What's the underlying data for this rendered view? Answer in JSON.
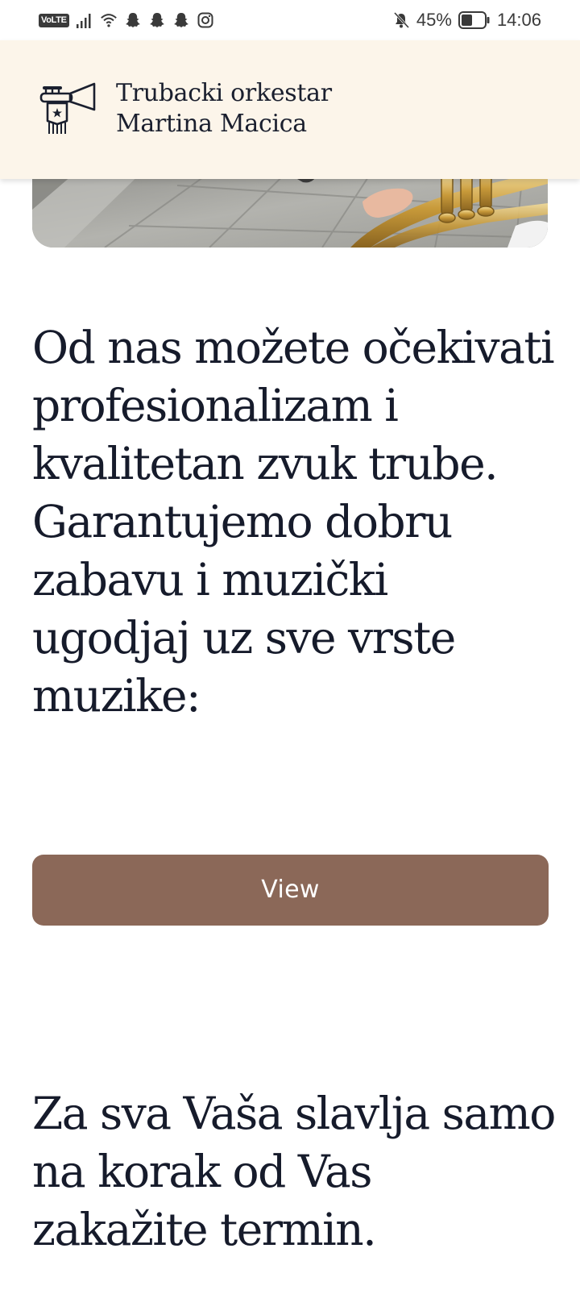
{
  "status_bar": {
    "network_badge": "VoLTE",
    "battery_percent": "45%",
    "time": "14:06",
    "icons": [
      "signal-icon",
      "wifi-icon",
      "snapchat-icon",
      "snapchat-icon",
      "snapchat-icon",
      "instagram-icon",
      "bell-off-icon",
      "battery-icon"
    ]
  },
  "header": {
    "brand_line1": "Trubacki orkestar",
    "brand_line2": "Martina Macica",
    "logo_icon": "trumpet-logo-icon",
    "background": "#fcf5ea"
  },
  "hero_image": {
    "subject": "trumpet"
  },
  "main": {
    "intro_text": "Od nas možete očekivati profesionalizam i kvalitetan zvuk trube. Garantujemo dobru zabavu i muzički ugodjaj uz sve vrste muzike:",
    "view_button_label": "View",
    "cta_text": "Za sva Vaša slavlja samo na korak od Vas zakažite termin."
  },
  "colors": {
    "accent_button": "#8b6858",
    "text_dark": "#161b2b",
    "header_bg": "#fcf5ea"
  }
}
